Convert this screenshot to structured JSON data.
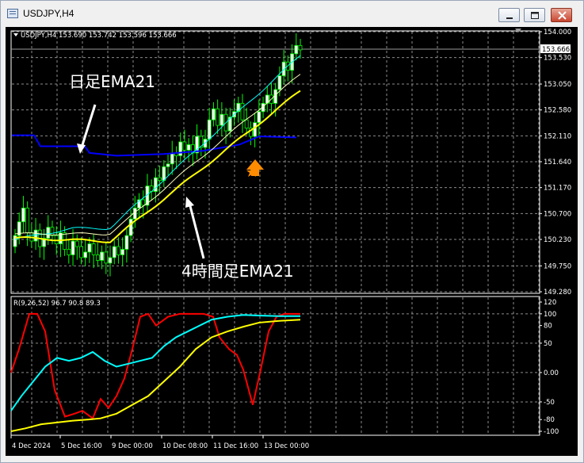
{
  "window": {
    "title": "USDJPY,H4"
  },
  "chart": {
    "header": "USDJPY,H4  153.690 153.742 153.596 153.666",
    "current_price": "153.666",
    "price_axis": [
      "154.000",
      "153.530",
      "153.050",
      "152.580",
      "152.110",
      "151.640",
      "151.170",
      "150.700",
      "150.230",
      "149.750",
      "149.280"
    ],
    "annotations": {
      "daily_ema": "日足EMA21",
      "h4_ema": "4時間足EMA21"
    },
    "indicator": {
      "header": "R(9,26,52) 96.7 90.8 89.3",
      "axis": [
        "120",
        "100",
        "80",
        "50",
        "0.00",
        "-50",
        "-80",
        "-100"
      ]
    },
    "time_axis": [
      "4 Dec 2024",
      "5 Dec 16:00",
      "9 Dec 00:00",
      "10 Dec 08:00",
      "11 Dec 16:00",
      "13 Dec 00:00"
    ]
  },
  "colors": {
    "background": "#000000",
    "grid": "#8c8c8c",
    "bull_candle": "#ffffff",
    "bear_candle": "#000000",
    "candle_outline": "#00ff00",
    "daily_ema": "#0000ff",
    "h4_ema": "#ffff00",
    "ma_thin": "#ffffc0",
    "ma_cyan": "#00ffff",
    "rci_short": "#ff0000",
    "rci_mid": "#00ffff",
    "rci_long": "#ffff00",
    "signal_arrow": "#ff8c00"
  }
}
